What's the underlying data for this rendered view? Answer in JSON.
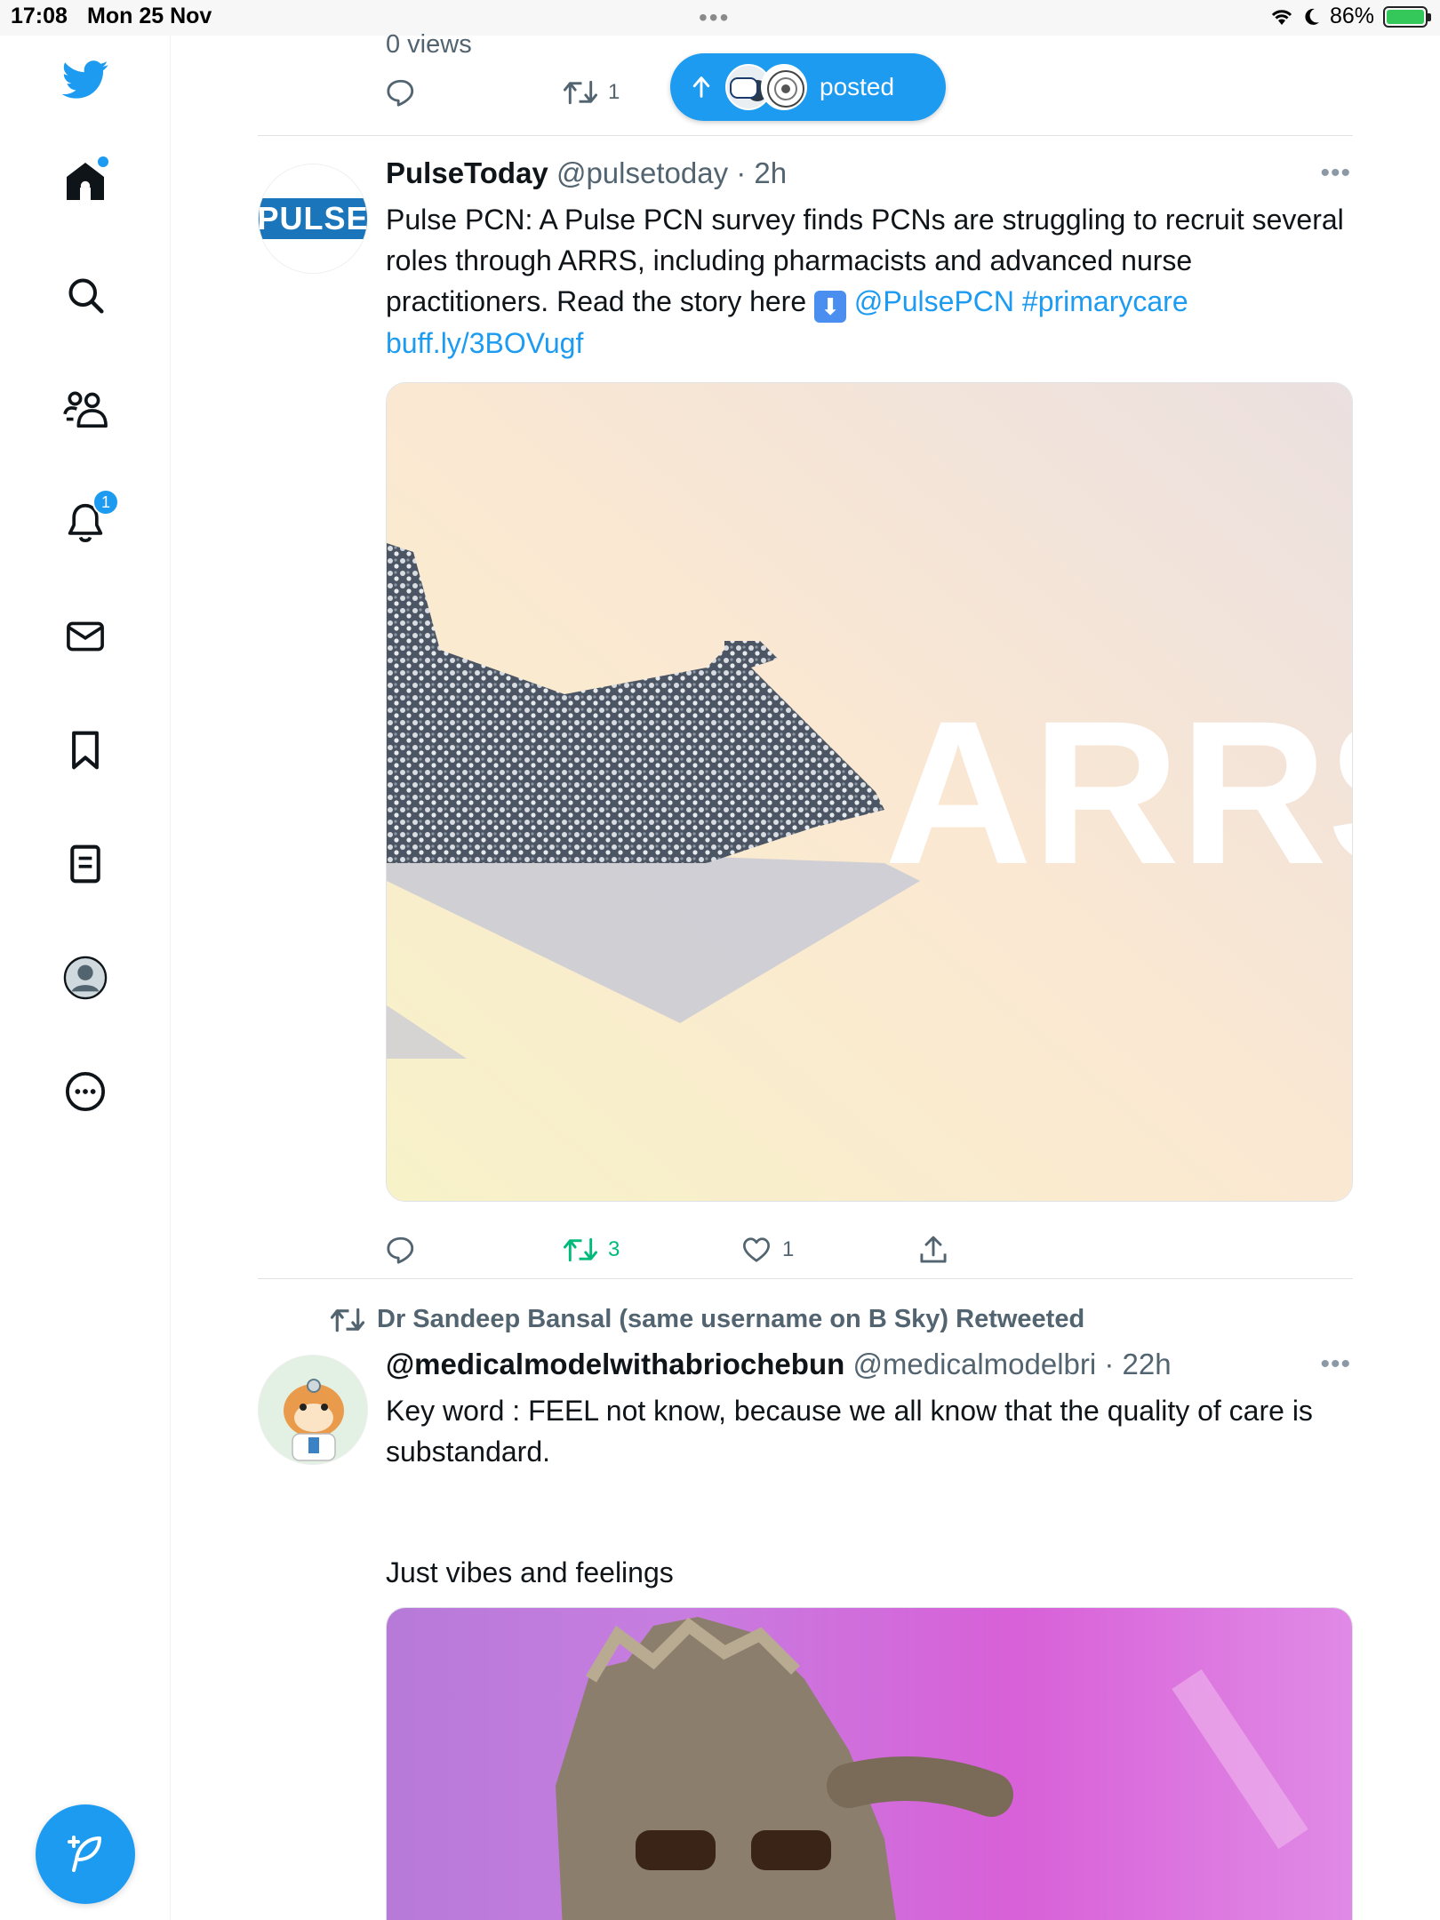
{
  "status_bar": {
    "time": "17:08",
    "date": "Mon 25 Nov",
    "battery": "86%"
  },
  "sidebar": {
    "items": [
      {
        "icon": "twitter-bird-icon"
      },
      {
        "icon": "home-icon",
        "dot": true
      },
      {
        "icon": "search-icon"
      },
      {
        "icon": "communities-icon"
      },
      {
        "icon": "bell-icon",
        "badge": "1"
      },
      {
        "icon": "mail-icon"
      },
      {
        "icon": "bookmark-icon"
      },
      {
        "icon": "lists-icon"
      },
      {
        "icon": "profile-icon"
      },
      {
        "icon": "more-circle-icon"
      }
    ],
    "compose_icon": "compose-feather-icon"
  },
  "top_tweet": {
    "views": "0 views",
    "retweets": "1"
  },
  "new_posts_pill": {
    "label": "posted"
  },
  "tweet1": {
    "name": "PulseToday",
    "handle": "@pulsetoday",
    "time": "2h",
    "avatar_text": "PULSE",
    "text_main": "Pulse PCN: A Pulse PCN survey finds PCNs are struggling to recruit several roles through ARRS, including pharmacists and advanced nurse practitioners. Read the story here ",
    "mention": "@PulsePCN",
    "hashtag": "#primarycare",
    "url": "buff.ly/3BOVugf",
    "image_text": "ARRS",
    "retweets": "3",
    "likes": "1"
  },
  "tweet2": {
    "retweeted_by": "Dr Sandeep Bansal (same username on B Sky) Retweeted",
    "name": "@medicalmodelwithabriochebun",
    "handle": "@medicalmodelbri",
    "time": "22h",
    "text_line1": "Key word : FEEL not know,  because we all know that the quality of care is substandard.",
    "text_line2": "Just vibes and feelings"
  },
  "colors": {
    "accent": "#1d9bf0",
    "retweet_green": "#00ba7c",
    "muted": "#536471"
  }
}
